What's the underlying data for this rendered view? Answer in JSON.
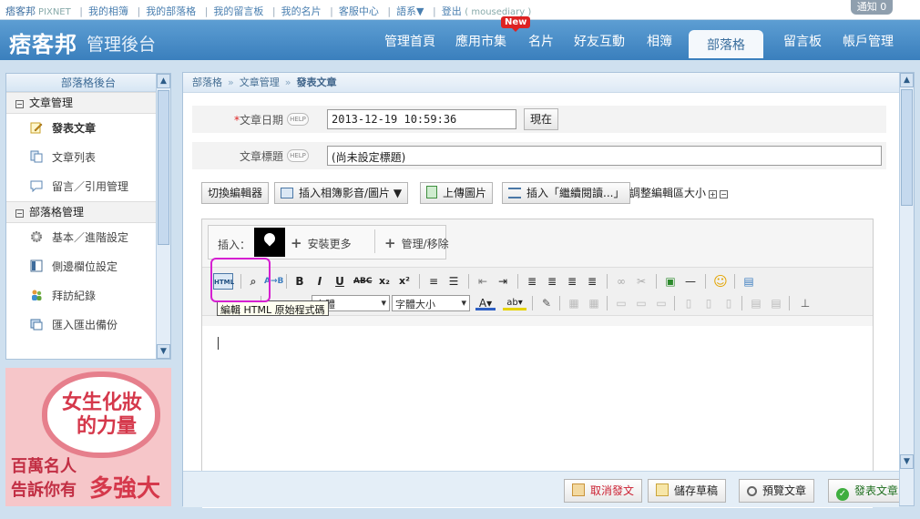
{
  "topbar": {
    "brand": "痞客邦",
    "pixnet": "PIXNET",
    "links": [
      "我的相簿",
      "我的部落格",
      "我的留言板",
      "我的名片",
      "客服中心",
      "語系▼",
      "登出"
    ],
    "user": "( mousediary )",
    "notice": "通知 0"
  },
  "header": {
    "logo": "痞客邦",
    "title": "管理後台",
    "nav": [
      {
        "label": "管理首頁"
      },
      {
        "label": "應用市集"
      },
      {
        "label": "名片"
      },
      {
        "label": "好友互動"
      },
      {
        "label": "相簿"
      },
      {
        "label": "部落格"
      },
      {
        "label": "留言板"
      },
      {
        "label": "帳戶管理"
      }
    ],
    "new_badge": "New"
  },
  "sidebar": {
    "title": "部落格後台",
    "section1": "文章管理",
    "items1": [
      "發表文章",
      "文章列表",
      "留言／引用管理"
    ],
    "section2": "部落格管理",
    "items2": [
      "基本／進階設定",
      "側邊欄位設定",
      "拜訪紀錄",
      "匯入匯出備份"
    ]
  },
  "ad": {
    "line1": "女生化妝",
    "line2": "的力量",
    "line3": "百萬名人",
    "line4": "告訴你有",
    "line5": "多強大"
  },
  "breadcrumb": {
    "items": [
      "部落格",
      "文章管理"
    ],
    "current": "發表文章"
  },
  "form": {
    "date_label": "文章日期",
    "date_value": "2013-12-19 10:59:36",
    "now_button": "現在",
    "title_label": "文章標題",
    "title_value": "(尚未設定標題)",
    "help": "HELP"
  },
  "editor_toolbar": {
    "switch_editor": "切換編輯器",
    "insert_media": "插入相簿影音/圖片 ▼",
    "upload_image": "上傳圖片",
    "insert_readmore": "插入「繼續閱讀...」",
    "resize_label": "調整編輯區大小"
  },
  "insert_bar": {
    "label": "插入：",
    "install_more": "安裝更多",
    "manage": "管理/移除"
  },
  "rte": {
    "font_select": "字體",
    "size_select": "字體大小",
    "tooltip": "編輯 HTML 原始程式碼",
    "html_button": "HTML"
  },
  "actions": {
    "cancel": "取消發文",
    "save_draft": "儲存草稿",
    "preview": "預覽文章",
    "publish": "發表文章"
  }
}
